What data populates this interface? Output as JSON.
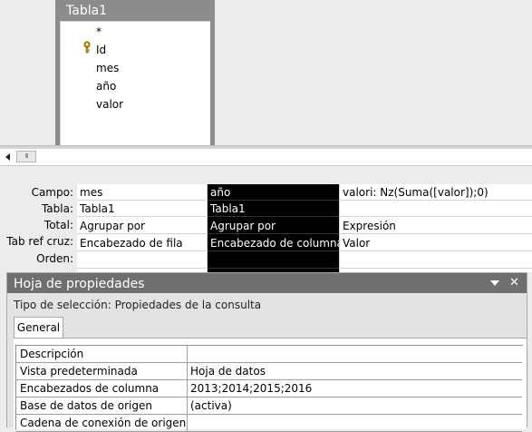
{
  "table": {
    "title": "Tabla1",
    "fields": [
      "*",
      "Id",
      "mes",
      "año",
      "valor"
    ]
  },
  "scrollbar": {
    "thumb_grip": "III"
  },
  "grid": {
    "row_labels": [
      "Campo:",
      "Tabla:",
      "Total:",
      "Tab ref cruz:",
      "Orden:"
    ],
    "columns": [
      {
        "campo": "mes",
        "tabla": "Tabla1",
        "total": "Agrupar por",
        "tab_ref_cruz": "Encabezado de fila",
        "orden": ""
      },
      {
        "campo": "año",
        "tabla": "Tabla1",
        "total": "Agrupar por",
        "tab_ref_cruz": "Encabezado de columna",
        "orden": ""
      },
      {
        "campo": "valori: Nz(Suma([valor]);0)",
        "tabla": "",
        "total": "Expresión",
        "tab_ref_cruz": "Valor",
        "orden": ""
      }
    ]
  },
  "property_sheet": {
    "title": "Hoja de propiedades",
    "close_glyph": "✕",
    "selection_type": "Tipo de selección:  Propiedades de la consulta",
    "tab_general": "General",
    "rows": [
      {
        "name": "Descripción",
        "value": ""
      },
      {
        "name": "Vista predeterminada",
        "value": "Hoja de datos"
      },
      {
        "name": "Encabezados de columna",
        "value": "2013;2014;2015;2016"
      },
      {
        "name": "Base de datos de origen",
        "value": "(activa)"
      },
      {
        "name": "Cadena de conexión de origen",
        "value": ""
      }
    ]
  },
  "colors": {
    "selected_column": "#000000",
    "property_header": "#6f6f6f",
    "table_box": "#8c8c8c"
  }
}
